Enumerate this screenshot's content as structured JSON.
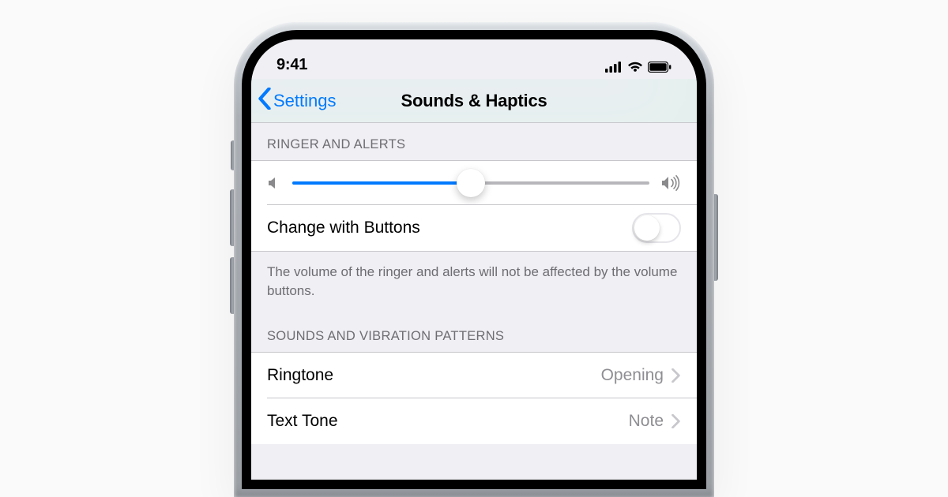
{
  "status": {
    "time": "9:41"
  },
  "nav": {
    "back": "Settings",
    "title": "Sounds & Haptics"
  },
  "section1": {
    "header": "RINGER AND ALERTS",
    "slider_percent": 50,
    "change_label": "Change with Buttons",
    "change_on": false,
    "footer": "The volume of the ringer and alerts will not be affected by the volume buttons."
  },
  "section2": {
    "header": "SOUNDS AND VIBRATION PATTERNS",
    "rows": [
      {
        "label": "Ringtone",
        "value": "Opening"
      },
      {
        "label": "Text Tone",
        "value": "Note"
      }
    ]
  }
}
